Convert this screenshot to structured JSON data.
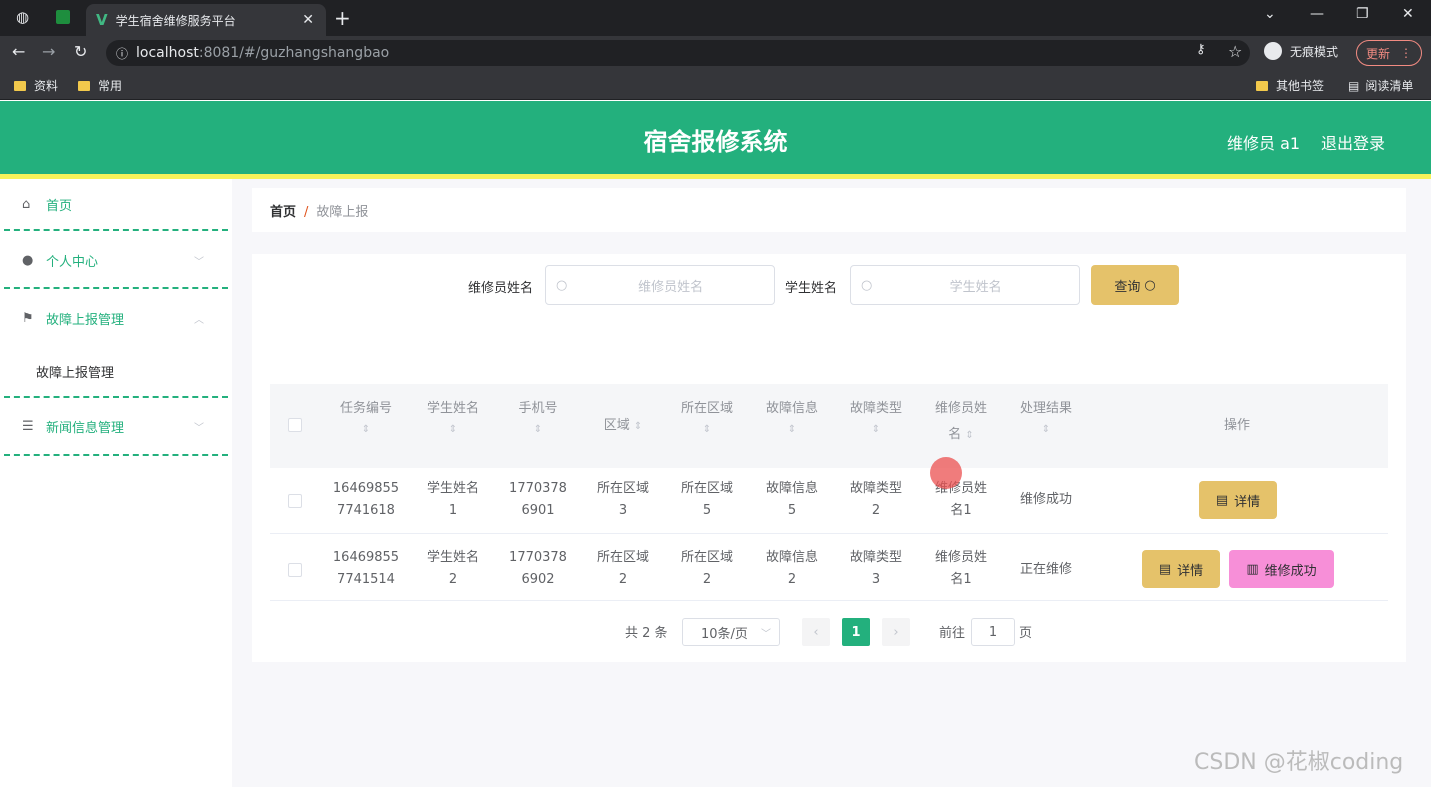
{
  "browser": {
    "tab_title": "学生宿舍维修服务平台",
    "url_host": "localhost",
    "url_path": ":8081/#/guzhangshangbao",
    "incognito_label": "无痕模式",
    "update_label": "更新",
    "bookmarks": [
      "资料",
      "常用"
    ],
    "bookmarks_right": [
      "其他书签",
      "阅读清单"
    ]
  },
  "header": {
    "title": "宿舍报修系统",
    "user": "维修员 a1",
    "logout": "退出登录"
  },
  "sidebar": {
    "items": [
      {
        "label": "首页",
        "icon": "home-icon"
      },
      {
        "label": "个人中心",
        "icon": "user-icon"
      },
      {
        "label": "故障上报管理",
        "icon": "flag-icon"
      },
      {
        "label": "新闻信息管理",
        "icon": "list-icon"
      }
    ],
    "sub_item": "故障上报管理"
  },
  "breadcrumb": {
    "home": "首页",
    "separator": "/",
    "current": "故障上报"
  },
  "search": {
    "repairer_label": "维修员姓名",
    "repairer_placeholder": "维修员姓名",
    "student_label": "学生姓名",
    "student_placeholder": "学生姓名",
    "query_button": "查询"
  },
  "table": {
    "headers": {
      "task_no": "任务编号",
      "student_name": "学生姓名",
      "phone": "手机号",
      "area": "区域",
      "located_area": "所在区域",
      "fault_info": "故障信息",
      "fault_type": "故障类型",
      "repairer_name_1": "维修员姓",
      "repairer_name_2": "名",
      "result": "处理结果",
      "actions": "操作"
    },
    "rows": [
      {
        "task_no_1": "16469855",
        "task_no_2": "7741618",
        "student_1": "学生姓名",
        "student_2": "1",
        "phone_1": "1770378",
        "phone_2": "6901",
        "area_1": "所在区域",
        "area_2": "3",
        "located_1": "所在区域",
        "located_2": "5",
        "fault_1": "故障信息",
        "fault_2": "5",
        "type_1": "故障类型",
        "type_2": "2",
        "repairer_1": "维修员姓",
        "repairer_2": "名1",
        "result": "维修成功",
        "detail_btn": "详情"
      },
      {
        "task_no_1": "16469855",
        "task_no_2": "7741514",
        "student_1": "学生姓名",
        "student_2": "2",
        "phone_1": "1770378",
        "phone_2": "6902",
        "area_1": "所在区域",
        "area_2": "2",
        "located_1": "所在区域",
        "located_2": "2",
        "fault_1": "故障信息",
        "fault_2": "2",
        "type_1": "故障类型",
        "type_2": "3",
        "repairer_1": "维修员姓",
        "repairer_2": "名1",
        "result": "正在维修",
        "detail_btn": "详情",
        "success_btn": "维修成功"
      }
    ]
  },
  "pagination": {
    "total": "共 2 条",
    "page_size": "10条/页",
    "current_page": "1",
    "goto_label": "前往",
    "goto_value": "1",
    "page_unit": "页"
  },
  "watermark": "CSDN @花椒coding",
  "colors": {
    "primary": "#23b07d",
    "accent_line": "#f6f25a",
    "detail_button": "#e5c26a",
    "success_button": "#f78fd8"
  }
}
